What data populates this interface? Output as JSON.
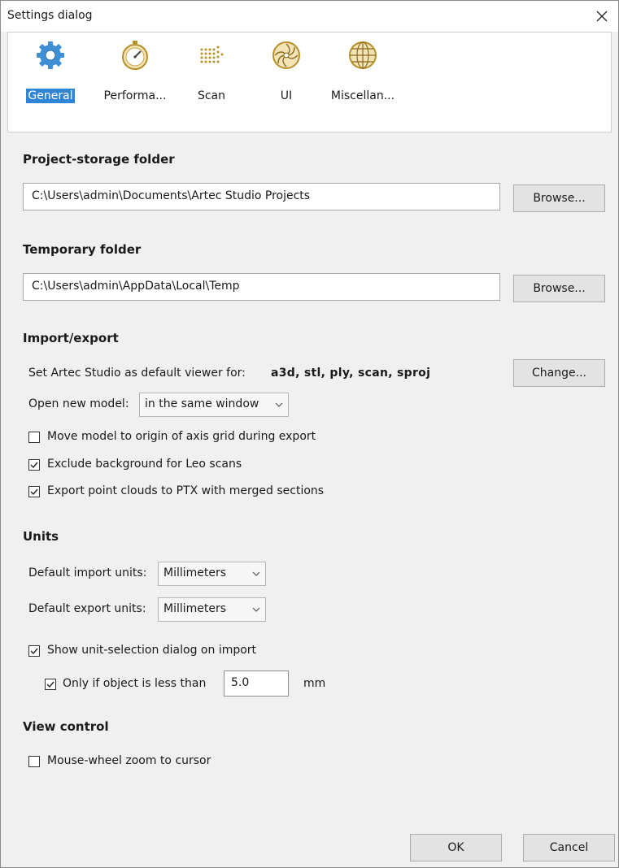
{
  "window": {
    "title": "Settings dialog"
  },
  "tabs": [
    {
      "label": "General",
      "icon": "gear-icon",
      "active": true
    },
    {
      "label": "Performa...",
      "icon": "stopwatch-icon"
    },
    {
      "label": "Scan",
      "icon": "dot-grid-icon"
    },
    {
      "label": "UI",
      "icon": "aperture-icon"
    },
    {
      "label": "Miscellan...",
      "icon": "globe-icon"
    }
  ],
  "project_storage": {
    "title": "Project-storage folder",
    "path": "C:\\Users\\admin\\Documents\\Artec Studio Projects",
    "browse_label": "Browse..."
  },
  "temporary": {
    "title": "Temporary folder",
    "path": "C:\\Users\\admin\\AppData\\Local\\Temp",
    "browse_label": "Browse..."
  },
  "import_export": {
    "title": "Import/export",
    "default_viewer_label": "Set Artec Studio as default viewer for:",
    "default_viewer_formats": "a3d, stl, ply, scan, sproj",
    "change_label": "Change...",
    "open_new_model_label": "Open new model:",
    "open_new_model_value": "in the same window",
    "checkboxes": [
      {
        "label": "Move model to origin of axis grid during export",
        "checked": false
      },
      {
        "label": "Exclude background for Leo scans",
        "checked": true
      },
      {
        "label": "Export point clouds to PTX with merged sections",
        "checked": true
      }
    ]
  },
  "units": {
    "title": "Units",
    "import_label": "Default import units:",
    "import_value": "Millimeters",
    "export_label": "Default export units:",
    "export_value": "Millimeters",
    "show_dialog_label": "Show unit-selection dialog on import",
    "show_dialog_checked": true,
    "only_if_label": "Only if object is less than",
    "only_if_checked": true,
    "threshold_value": "5.0",
    "threshold_unit": "mm"
  },
  "view_control": {
    "title": "View control",
    "mouse_wheel_label": "Mouse-wheel zoom to cursor",
    "mouse_wheel_checked": false
  },
  "footer": {
    "ok_label": "OK",
    "cancel_label": "Cancel"
  },
  "colors": {
    "accent": "#2f86d6",
    "gear": "#3f8fd6",
    "icon_gold": "#b8902a"
  }
}
